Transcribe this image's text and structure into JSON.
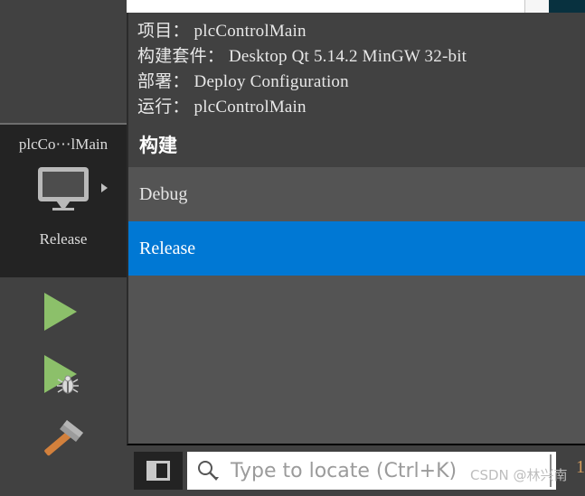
{
  "window": {
    "top_strip": {
      "white_color": "#ffffff",
      "gray_color": "#f6f6f6",
      "teal_color": "#08313f"
    }
  },
  "sidebar": {
    "kit_selector": {
      "project_name": "plcCo⋯lMain",
      "target_icon": "desktop-monitor-icon",
      "expand_arrow": "chevron-right-icon",
      "build_configuration": "Release"
    },
    "actions": [
      {
        "name": "run",
        "icon": "play-triangle-icon",
        "color": "#8cc06a"
      },
      {
        "name": "debug",
        "icon": "play-triangle-with-bug-icon",
        "color": "#8cc06a"
      },
      {
        "name": "build",
        "icon": "hammer-icon",
        "color": "#d2803c"
      }
    ]
  },
  "popup": {
    "summary": [
      "项目： plcControlMain",
      "构建套件： Desktop Qt 5.14.2 MinGW 32-bit",
      "部署： Deploy Configuration",
      "运行： plcControlMain"
    ],
    "section_header": "构建",
    "build_items": [
      {
        "label": "Debug",
        "selected": false
      },
      {
        "label": "Release",
        "selected": true
      }
    ],
    "selected_color": "#0078d4"
  },
  "bottom_bar": {
    "sidebar_toggle_icon": "panel-toggle-icon",
    "locator": {
      "search_icon": "search-magnifier-icon",
      "placeholder": "Type to locate (Ctrl+K)",
      "value": ""
    },
    "watermark": "CSDN @林兴南",
    "page_number": "1"
  }
}
